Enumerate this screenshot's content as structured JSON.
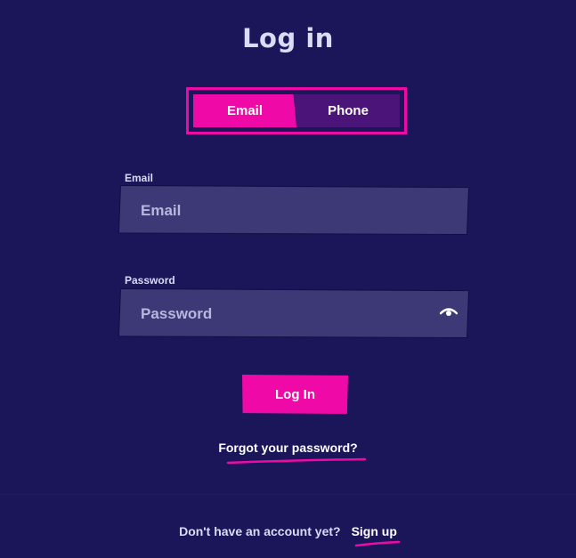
{
  "page": {
    "title": "Log in"
  },
  "toggle": {
    "email_label": "Email",
    "phone_label": "Phone",
    "selected": "Email"
  },
  "email_field": {
    "label": "Email",
    "placeholder": "Email",
    "value": ""
  },
  "password_field": {
    "label": "Password",
    "placeholder": "Password",
    "value": "",
    "toggle_icon": "eye-icon"
  },
  "actions": {
    "login_label": "Log In",
    "forgot_label": "Forgot your password?"
  },
  "footer": {
    "prompt": "Don't have an account yet?",
    "signup_label": "Sign up"
  },
  "colors": {
    "background": "#1b155a",
    "accent": "#ef0aa8",
    "input_bg": "#3d3977",
    "toggle_bg": "#4a1478",
    "text": "#d9dcf2"
  }
}
